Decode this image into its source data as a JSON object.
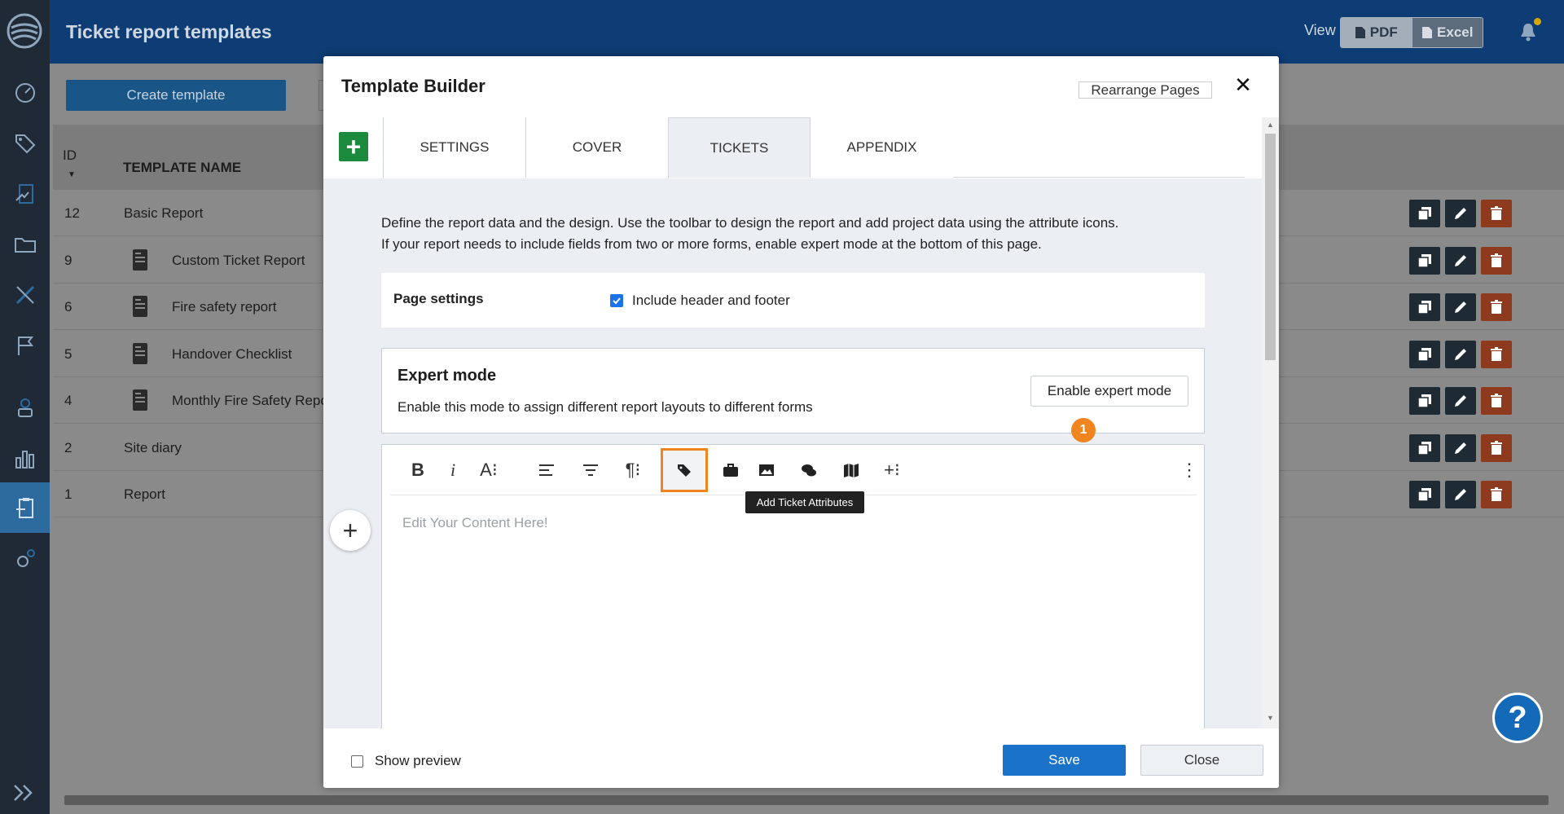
{
  "app": {
    "title": "Ticket report templates",
    "view_label": "View",
    "export_buttons": [
      {
        "label": "PDF",
        "icon": "pdf-file-icon"
      },
      {
        "label": "Excel",
        "icon": "excel-file-icon"
      }
    ]
  },
  "sidebar": {
    "items": [
      {
        "icon": "dashboard-gauge-icon"
      },
      {
        "icon": "tags-icon"
      },
      {
        "icon": "forms-icon"
      },
      {
        "icon": "folder-icon"
      },
      {
        "icon": "ruler-pencil-icon"
      },
      {
        "icon": "flag-icon"
      },
      {
        "icon": "user-icon"
      },
      {
        "icon": "bar-chart-icon"
      },
      {
        "icon": "report-clipboard-icon",
        "active": true
      },
      {
        "icon": "settings-gears-icon"
      }
    ]
  },
  "list": {
    "create_button": "Create template",
    "columns": {
      "id": "ID",
      "name": "TEMPLATE NAME"
    },
    "rows": [
      {
        "id": "12",
        "name": "Basic Report",
        "doc_icon": false
      },
      {
        "id": "9",
        "name": "Custom Ticket Report",
        "doc_icon": true
      },
      {
        "id": "6",
        "name": "Fire safety report",
        "doc_icon": true
      },
      {
        "id": "5",
        "name": "Handover Checklist",
        "doc_icon": true
      },
      {
        "id": "4",
        "name": "Monthly Fire Safety Repo",
        "doc_icon": true
      },
      {
        "id": "2",
        "name": "Site diary",
        "doc_icon": false
      },
      {
        "id": "1",
        "name": "Report",
        "doc_icon": false
      }
    ]
  },
  "modal": {
    "title": "Template Builder",
    "rearrange_button": "Rearrange Pages",
    "close_glyph": "✕",
    "add_page_glyph": "+",
    "tabs": [
      "SETTINGS",
      "COVER",
      "TICKETS",
      "APPENDIX"
    ],
    "active_tab": "TICKETS",
    "description_line1": "Define the report data and the design. Use the toolbar to design the report and add project data using the attribute icons.",
    "description_line2": "If your report needs to include fields from two or more forms, enable expert mode at the bottom of this page.",
    "page_settings": {
      "label": "Page settings",
      "include_header_footer_label": "Include header and footer",
      "include_header_footer_checked": true
    },
    "expert_mode": {
      "title": "Expert mode",
      "description": "Enable this mode to assign different report layouts to different forms",
      "button": "Enable expert mode"
    },
    "editor": {
      "toolbar": [
        {
          "name": "bold-button",
          "glyph": "B"
        },
        {
          "name": "italic-button",
          "glyph": "i"
        },
        {
          "name": "font-size-button",
          "glyph": "A⁝"
        },
        {
          "name": "align-left-button",
          "glyph": ""
        },
        {
          "name": "align-center-button",
          "glyph": ""
        },
        {
          "name": "paragraph-button",
          "glyph": "¶⁝"
        },
        {
          "name": "add-ticket-attributes-button",
          "glyph": ""
        },
        {
          "name": "briefcase-button",
          "glyph": ""
        },
        {
          "name": "image-button",
          "glyph": ""
        },
        {
          "name": "comments-button",
          "glyph": ""
        },
        {
          "name": "map-button",
          "glyph": ""
        },
        {
          "name": "insert-more-button",
          "glyph": "+⁝"
        },
        {
          "name": "more-options-button",
          "glyph": "⋮"
        }
      ],
      "highlight_badge": "1",
      "tooltip": "Add Ticket Attributes",
      "placeholder": "Edit Your Content Here!",
      "add_block_glyph": "+"
    },
    "footer": {
      "show_preview_label": "Show preview",
      "show_preview_checked": false,
      "save_button": "Save",
      "close_button": "Close"
    }
  },
  "help_button_glyph": "?",
  "colors": {
    "topbar": "#0d3d74",
    "sidebar": "#1f2a36",
    "primary": "#1a73c8",
    "accent_highlight": "#f0841e",
    "add_green": "#1c8a3c",
    "delete_red": "#8e3a1e"
  }
}
